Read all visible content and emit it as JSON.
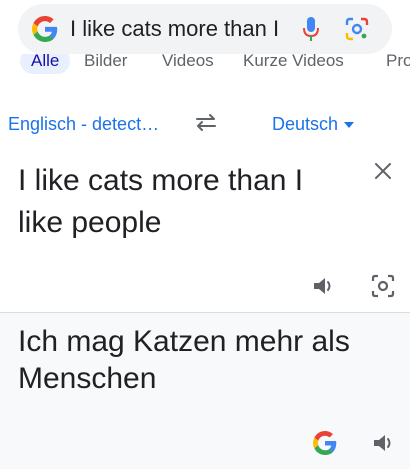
{
  "search": {
    "query": "I like cats more than I"
  },
  "tabs": [
    {
      "label": "Alle",
      "active": true
    },
    {
      "label": "Bilder",
      "active": false
    },
    {
      "label": "Videos",
      "active": false
    },
    {
      "label": "Kurze Videos",
      "active": false
    },
    {
      "label": "Pro",
      "active": false
    }
  ],
  "translator": {
    "source_language": "Englisch - detect…",
    "target_language": "Deutsch",
    "source_text": "I like cats more than I like people",
    "translated_text": "Ich mag Katzen mehr als Menschen"
  },
  "colors": {
    "accent": "#1a73e8",
    "text": "#202124",
    "icon": "#5f6368",
    "divider": "#dadce0"
  },
  "icons": [
    "google-g-icon",
    "mic-icon",
    "lens-icon",
    "swap-icon",
    "chevron-down-icon",
    "close-icon",
    "speaker-icon",
    "camera-icon"
  ]
}
